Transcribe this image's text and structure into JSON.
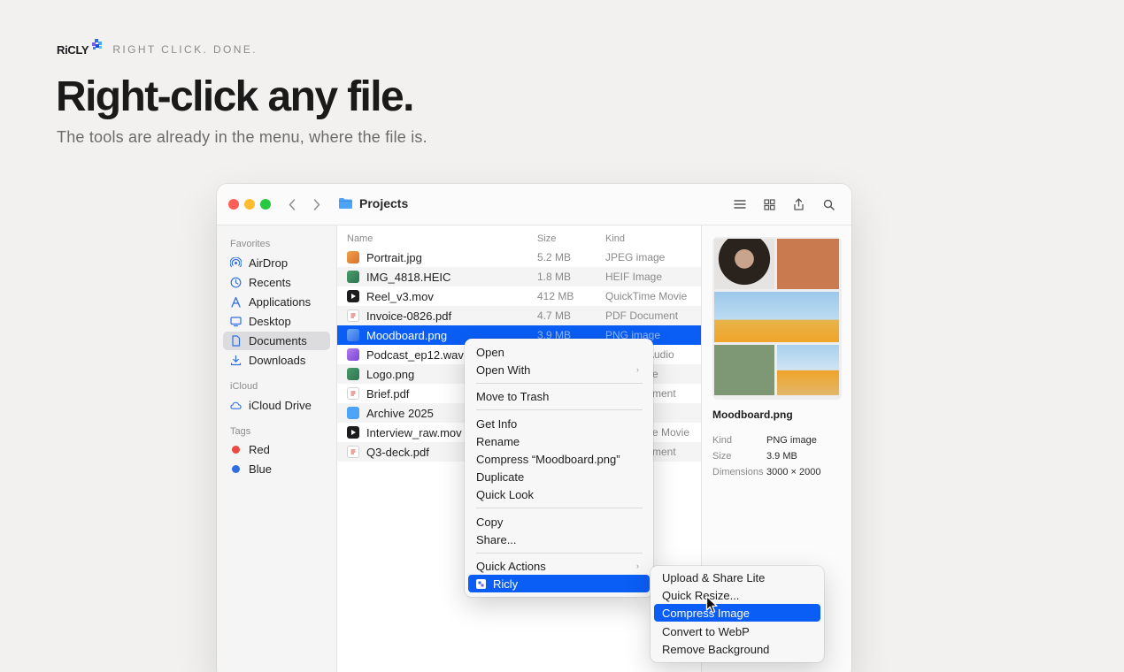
{
  "hero": {
    "brand": "RiCLY",
    "tagline": "RIGHT CLICK. DONE.",
    "headline": "Right-click any file.",
    "subhead": "The tools are already in the menu, where the file is."
  },
  "window": {
    "folder_title": "Projects",
    "sidebar": {
      "favorites_label": "Favorites",
      "favorites": [
        {
          "label": "AirDrop",
          "icon": "airdrop-icon"
        },
        {
          "label": "Recents",
          "icon": "clock-icon"
        },
        {
          "label": "Applications",
          "icon": "applications-icon"
        },
        {
          "label": "Desktop",
          "icon": "desktop-icon"
        },
        {
          "label": "Documents",
          "icon": "document-icon",
          "active": true
        },
        {
          "label": "Downloads",
          "icon": "download-icon"
        }
      ],
      "icloud_label": "iCloud",
      "icloud": [
        {
          "label": "iCloud Drive",
          "icon": "cloud-icon"
        }
      ],
      "tags_label": "Tags",
      "tags": [
        {
          "label": "Red",
          "color": "#ee4a3f"
        },
        {
          "label": "Blue",
          "color": "#2f6fe4"
        }
      ]
    },
    "columns": {
      "name": "Name",
      "size": "Size",
      "kind": "Kind"
    },
    "files": [
      {
        "name": "Portrait.jpg",
        "size": "5.2 MB",
        "kind": "JPEG image",
        "color": "#e58a3a"
      },
      {
        "name": "IMG_4818.HEIC",
        "size": "1.8 MB",
        "kind": "HEIF Image",
        "color": "#3d8b5c"
      },
      {
        "name": "Reel_v3.mov",
        "size": "412 MB",
        "kind": "QuickTime Movie",
        "color": "#1d1d1f"
      },
      {
        "name": "Invoice-0826.pdf",
        "size": "4.7 MB",
        "kind": "PDF Document",
        "color": "#ffffff"
      },
      {
        "name": "Moodboard.png",
        "size": "3.9 MB",
        "kind": "PNG image",
        "color": "#4a8cf2",
        "selected": true
      },
      {
        "name": "Podcast_ep12.wav",
        "size": "",
        "kind": "Audio",
        "color": "#9a5de0"
      },
      {
        "name": "Logo.png",
        "size": "",
        "kind": "e",
        "color": "#3d8b5c"
      },
      {
        "name": "Brief.pdf",
        "size": "",
        "kind": "ment",
        "color": "#ffffff"
      },
      {
        "name": "Archive 2025",
        "size": "",
        "kind": "",
        "color": "#4da3f5"
      },
      {
        "name": "Interview_raw.mov",
        "size": "",
        "kind": "e Movie",
        "color": "#1d1d1f"
      },
      {
        "name": "Q3-deck.pdf",
        "size": "",
        "kind": "ment",
        "color": "#ffffff"
      }
    ],
    "preview": {
      "name": "Moodboard.png",
      "rows": [
        {
          "label": "Kind",
          "value": "PNG image"
        },
        {
          "label": "Size",
          "value": "3.9 MB"
        },
        {
          "label": "Dimensions",
          "value": "3000 × 2000"
        }
      ]
    }
  },
  "context_menu": {
    "items": [
      {
        "label": "Open"
      },
      {
        "label": "Open With",
        "submenu": true
      },
      {
        "label": "Move to Trash"
      },
      {
        "label": "Get Info"
      },
      {
        "label": "Rename"
      },
      {
        "label": "Compress “Moodboard.png”"
      },
      {
        "label": "Duplicate"
      },
      {
        "label": "Quick Look"
      },
      {
        "label": "Copy"
      },
      {
        "label": "Share..."
      },
      {
        "label": "Quick Actions",
        "submenu": true
      },
      {
        "label": "Ricly",
        "highlighted": true
      }
    ]
  },
  "submenu": {
    "items": [
      {
        "label": "Upload & Share Lite"
      },
      {
        "label": "Quick Resize..."
      },
      {
        "label": "Compress Image",
        "highlighted": true
      },
      {
        "label": "Convert to WebP"
      },
      {
        "label": "Remove Background"
      }
    ]
  },
  "colors": {
    "accent": "#0a5ef5",
    "background": "#f2f1ef"
  }
}
